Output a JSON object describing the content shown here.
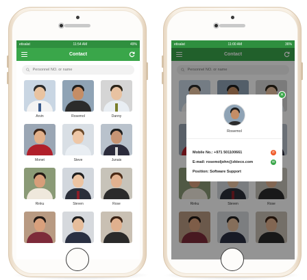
{
  "phone_left": {
    "status": {
      "carrier": "etisalat",
      "time": "11:54 AM",
      "battery": "49%"
    },
    "appbar": {
      "title": "Contact"
    },
    "search": {
      "placeholder": "Personnel NO. or name"
    },
    "contacts": [
      {
        "name": "Arvin",
        "bg": "#c9d6e3",
        "skin": "#e9c3a0",
        "hair": "#2a2a2a",
        "body": "#f3f3f3",
        "tie": "#3b5a8a"
      },
      {
        "name": "Rosemol",
        "bg": "#8fa3b5",
        "skin": "#c58d65",
        "hair": "#1d1d1d",
        "body": "#2b2b2b",
        "tie": ""
      },
      {
        "name": "Danny",
        "bg": "#d5d5d5",
        "skin": "#e8c2a1",
        "hair": "#2b2418",
        "body": "#e9eef3",
        "tie": "#7a7f2b"
      },
      {
        "name": "Monet",
        "bg": "#9aa6b4",
        "skin": "#e2b08a",
        "hair": "#3a2418",
        "body": "#b01f2a",
        "tie": ""
      },
      {
        "name": "Steve",
        "bg": "#d9dfe5",
        "skin": "#eec7a7",
        "hair": "#6b4a2b",
        "body": "#e9eef3",
        "tie": ""
      },
      {
        "name": "Junais",
        "bg": "#b9c2cc",
        "skin": "#c69474",
        "hair": "#1d1d1d",
        "body": "#2b2b3b",
        "tie": "#d9d9d9"
      },
      {
        "name": "Rinku",
        "bg": "#8a9a76",
        "skin": "#d79e7a",
        "hair": "#231a14",
        "body": "#efe8dc",
        "tie": ""
      },
      {
        "name": "Steven",
        "bg": "#d2d7dd",
        "skin": "#ecc4a2",
        "hair": "#1f1f1f",
        "body": "#2a2f3a",
        "tie": "#8a1f2a"
      },
      {
        "name": "Rose",
        "bg": "#c7c3b9",
        "skin": "#e2b290",
        "hair": "#4a2a16",
        "body": "#2b2b2b",
        "tie": ""
      },
      {
        "name": "",
        "bg": "#b89a82",
        "skin": "#d9a07c",
        "hair": "#1f1713",
        "body": "#7d2b3a",
        "tie": ""
      },
      {
        "name": "",
        "bg": "#d6d9dd",
        "skin": "#e6bd9b",
        "hair": "#1f1f1f",
        "body": "#2a3042",
        "tie": ""
      },
      {
        "name": "",
        "bg": "#c9c0b3",
        "skin": "#e0b08e",
        "hair": "#3a2214",
        "body": "#2a2a2a",
        "tie": ""
      }
    ]
  },
  "phone_right": {
    "status": {
      "carrier": "etisalat",
      "time": "11:00 AM",
      "battery": "36%"
    },
    "appbar": {
      "title": "Contact"
    },
    "search": {
      "placeholder": "Personnel NO. or name"
    },
    "popup": {
      "name": "Rosemol",
      "mobile_label": "Mobile No.:",
      "mobile_value": "+971 501100661",
      "email_label": "E-mail:",
      "email_value": "rosemoljohn@zkteco.com",
      "position_label": "Position:",
      "position_value": "Software Support",
      "call_color": "#f05a28",
      "message_color": "#3aa64a"
    },
    "background_names": [
      "Rinku",
      "Steven",
      "Rose"
    ]
  },
  "colors": {
    "appbar": "#3aa64a",
    "statusbar": "#2f8f3f"
  }
}
